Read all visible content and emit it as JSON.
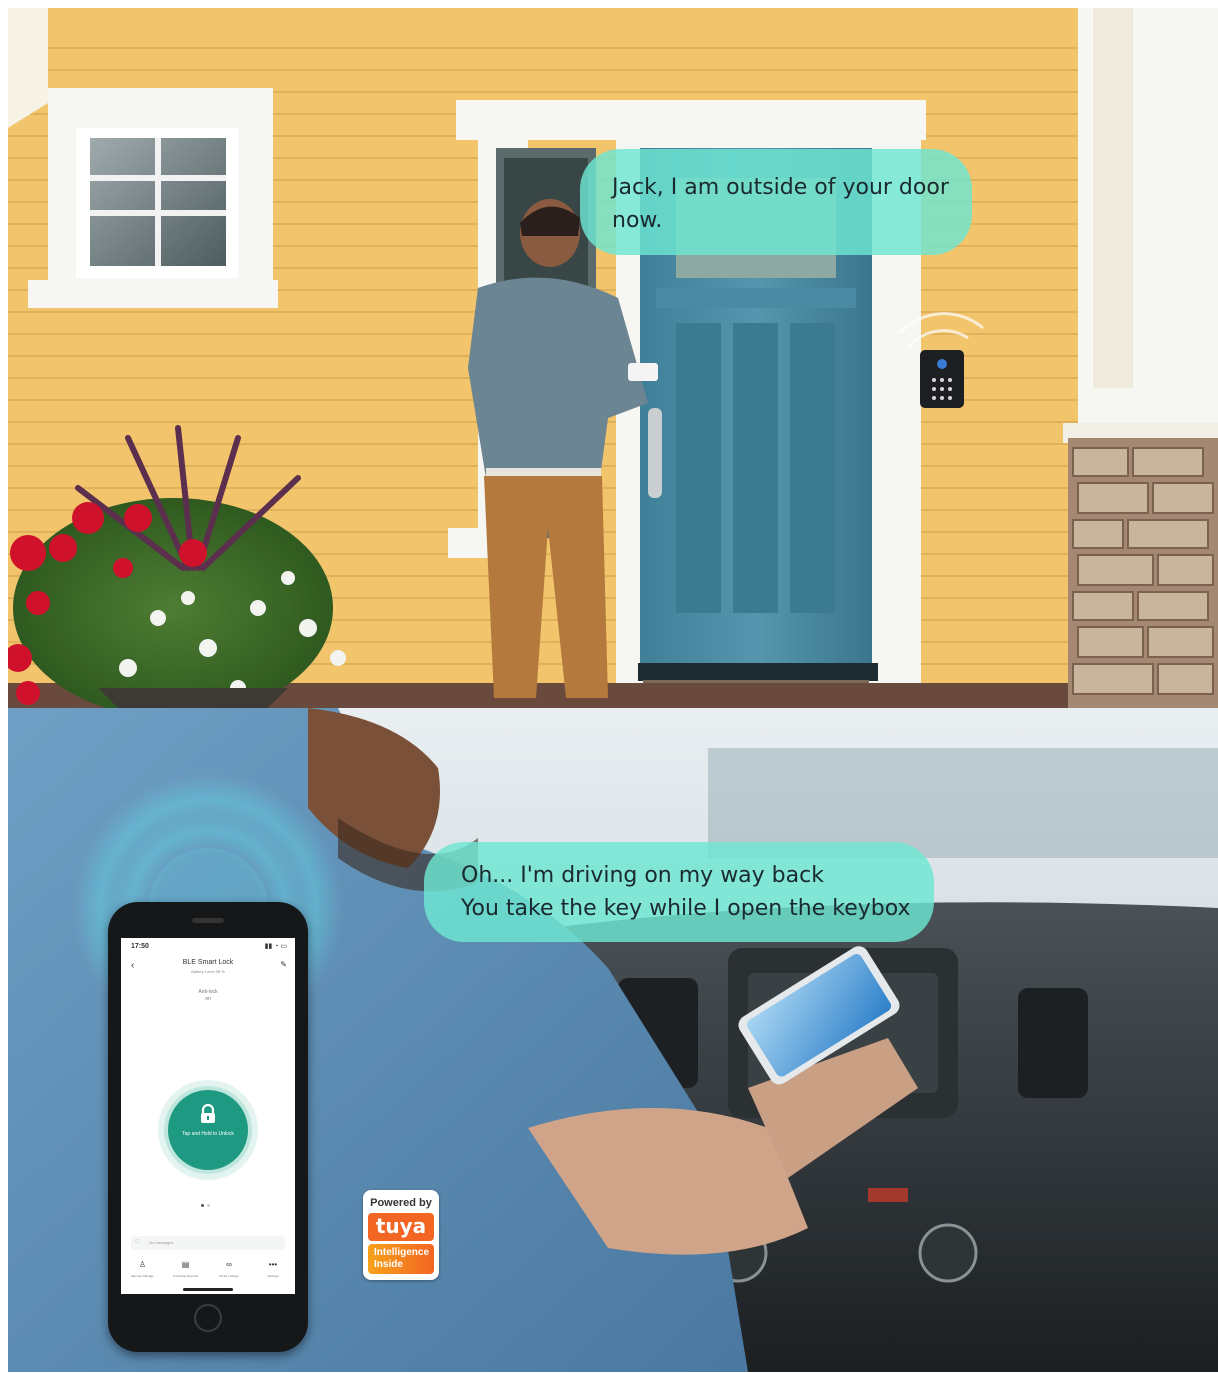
{
  "scene_top": {
    "speech_bubble": {
      "line1": "Jack, I am outside of  your door",
      "line2": "now."
    },
    "colors": {
      "siding": "#f2c46b",
      "door": "#4e8fa8",
      "bubble": "#6ee6d2"
    }
  },
  "scene_bottom": {
    "speech_bubble": {
      "line1": "Oh...  I'm driving on my way back",
      "line2": "You take the key while I open the keybox"
    },
    "phone_app": {
      "status_time": "17:50",
      "title": "BLE Smart Lock",
      "battery_label": "Battery Level 98 %",
      "anti_lock_label": "Anti-lock",
      "anti_lock_value": "on",
      "unlock_button_label": "Tap and Hold to Unlock",
      "messages_placeholder": "No messages",
      "nav_items": [
        "Member Manage",
        "Unlocking Records",
        "Smart Linkage",
        "Settings"
      ]
    },
    "badge": {
      "line1": "Powered by",
      "brand": "tuya",
      "line2": "Intelligence",
      "line3": "Inside"
    },
    "colors": {
      "app_accent": "#1f9a82",
      "badge_orange": "#f26522",
      "bubble": "#6ee6d2"
    }
  }
}
